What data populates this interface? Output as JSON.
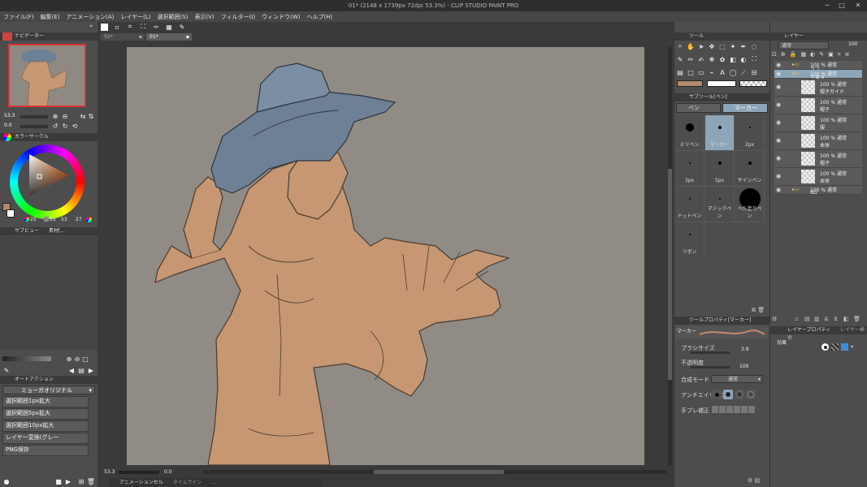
{
  "window": {
    "title": "01* (2148 x 1739px 72dpi 53.3%) - CLIP STUDIO PAINT PRO",
    "minimize": "─",
    "maximize": "□",
    "close": "✕"
  },
  "menu": [
    "ファイル(F)",
    "編集(E)",
    "アニメーション(A)",
    "レイヤー(L)",
    "選択範囲(S)",
    "表示(V)",
    "フィルター(I)",
    "ウィンドウ(W)",
    "ヘルプ(H)"
  ],
  "tabs": [
    {
      "label": "55*"
    },
    {
      "label": "01*"
    }
  ],
  "navigator": {
    "title": "ナビゲーター",
    "zoom": "53.3",
    "rotation": "0.0"
  },
  "color_wheel": {
    "title": "カラーサークル",
    "h": "25",
    "s": "55",
    "v": "53",
    "n4": "27"
  },
  "sub_view": {
    "title": "サブビュー",
    "title2": "素材[..."
  },
  "auto_action": {
    "title": "オートアクション",
    "set": "ミョーガオリジナル",
    "items": [
      "選択範囲1px拡大",
      "選択範囲5px拡大",
      "選択範囲10px拡大",
      "レイヤー変換(グレー",
      "PNG保存"
    ]
  },
  "tool_panel": {
    "title": "ツール"
  },
  "sub_tool": {
    "title": "サブツール[ペン]",
    "tabs": [
      "ペン",
      "マーカー"
    ],
    "brushes": [
      {
        "label": "ミリペン",
        "size": 5
      },
      {
        "label": "マーカー",
        "size": 2
      },
      {
        "label": "2px",
        "size": 1
      },
      {
        "label": "3px",
        "size": 1
      },
      {
        "label": "5px",
        "size": 2
      },
      {
        "label": "サインペン",
        "size": 2
      },
      {
        "label": "ドットペン",
        "size": 1
      },
      {
        "label": "マジックペン",
        "size": 1
      },
      {
        "label": "べた塗りペン",
        "size": 13
      },
      {
        "label": "リボン",
        "size": 1
      }
    ]
  },
  "tool_property": {
    "title": "ツールプロパティ[マーカー]",
    "brush_name": "マーカー",
    "brush_size_label": "ブラシサイズ",
    "brush_size_value": "3.9",
    "opacity_label": "不透明度",
    "opacity_value": "100",
    "blend_label": "合成モード",
    "blend_value": "通常",
    "aa_label": "アンチエイリアス",
    "stabilize_label": "手ブレ補正"
  },
  "layers": {
    "title": "レイヤー",
    "blend": "通常",
    "opacity": "100",
    "items": [
      {
        "line1": "100 % 通常",
        "line2": "ラフ",
        "folder": true
      },
      {
        "line1": "100 % 通常",
        "line2": "下書き",
        "folder": true,
        "selected": true
      },
      {
        "line1": "100 % 通常",
        "line2": "帽子ガイド"
      },
      {
        "line1": "100 % 通常",
        "line2": "帽子"
      },
      {
        "line1": "100 % 通常",
        "line2": "服"
      },
      {
        "line1": "100 % 通常",
        "line2": "本体"
      },
      {
        "line1": "100 % 通常",
        "line2": "帽子"
      },
      {
        "line1": "100 % 通常",
        "line2": "本体"
      },
      {
        "line1": "100 % 通常",
        "line2": "BG",
        "folder": true
      }
    ]
  },
  "layer_property": {
    "title": "レイヤープロパティ",
    "title2": "レイヤー検索",
    "effect_label": "効果"
  },
  "status": {
    "zoom": "53.3",
    "rotation": "0.0",
    "anim_tab": "アニメーションセル",
    "tab2": "タイムライン",
    "tab3": "..."
  },
  "colors": {
    "main": "#b28a6a",
    "sub": "#ffffff",
    "canvas_bg": "#918b86",
    "skin": "#c69772",
    "hat": "#6d8095"
  }
}
